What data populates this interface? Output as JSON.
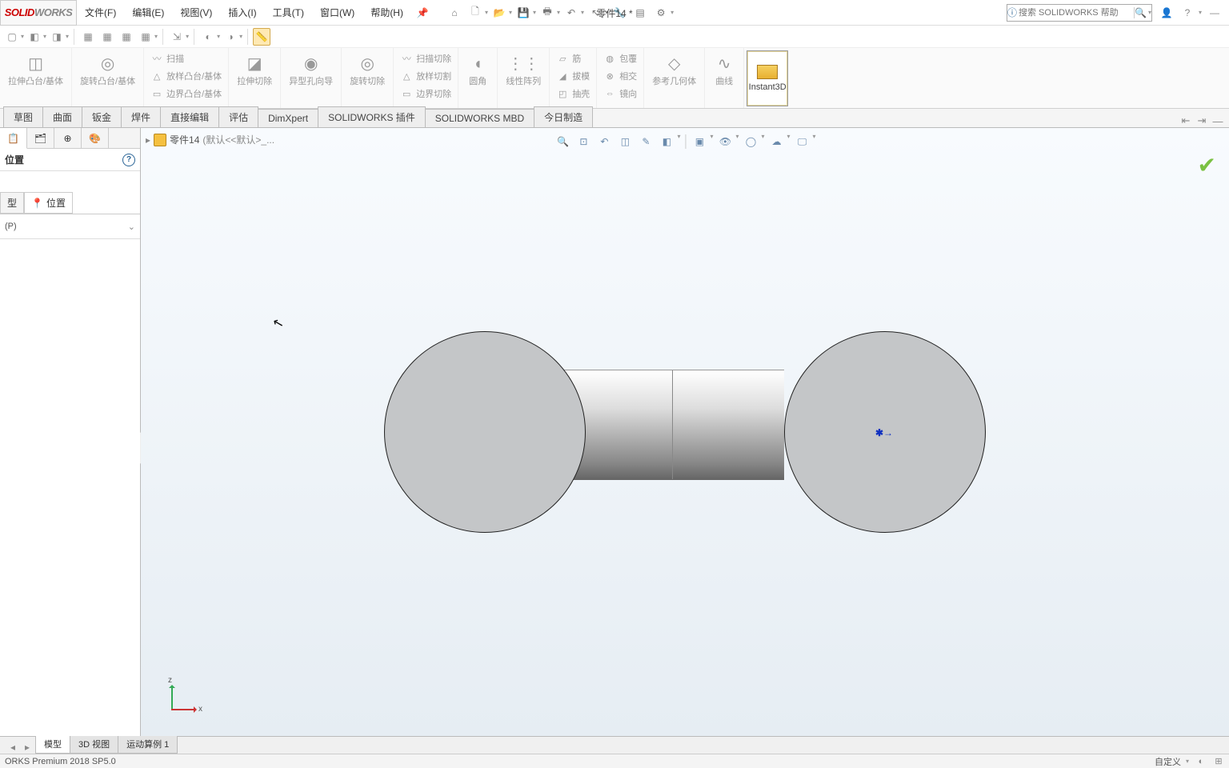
{
  "app": {
    "logo_a": "SOLID",
    "logo_b": "WORKS"
  },
  "menus": [
    "文件(F)",
    "编辑(E)",
    "视图(V)",
    "插入(I)",
    "工具(T)",
    "窗口(W)",
    "帮助(H)"
  ],
  "doc_title": "零件14 *",
  "search_placeholder": "搜索 SOLIDWORKS 帮助",
  "ribbon": {
    "ext_boss": "拉伸凸台/基体",
    "rev_boss": "旋转凸台/基体",
    "sweep": "扫描",
    "loft": "放样凸台/基体",
    "boundary": "边界凸台/基体",
    "ext_cut": "拉伸切除",
    "hole": "异型孔向导",
    "rev_cut": "旋转切除",
    "sweep_cut": "扫描切除",
    "loft_cut": "放样切割",
    "boundary_cut": "边界切除",
    "fillet": "圆角",
    "pattern": "线性阵列",
    "rib": "筋",
    "draft": "拔模",
    "shell": "抽壳",
    "wrap": "包覆",
    "intersect": "相交",
    "mirror": "镜向",
    "refgeo": "参考几何体",
    "curves": "曲线",
    "instant3d": "Instant3D"
  },
  "tabs": [
    "草图",
    "曲面",
    "钣金",
    "焊件",
    "直接编辑",
    "评估",
    "DimXpert",
    "SOLIDWORKS 插件",
    "SOLIDWORKS MBD",
    "今日制造"
  ],
  "sidebar": {
    "title": "位置",
    "subtab1": "型",
    "subtab2": "位置",
    "section_hdr": "(P)"
  },
  "breadcrumb": {
    "name": "零件14",
    "config": "(默认<<默认>_..."
  },
  "triad": {
    "x": "x",
    "z": "z"
  },
  "bottom_tabs": [
    "模型",
    "3D 视图",
    "运动算例 1"
  ],
  "status": {
    "version": "ORKS Premium 2018 SP5.0",
    "custom": "自定义"
  }
}
